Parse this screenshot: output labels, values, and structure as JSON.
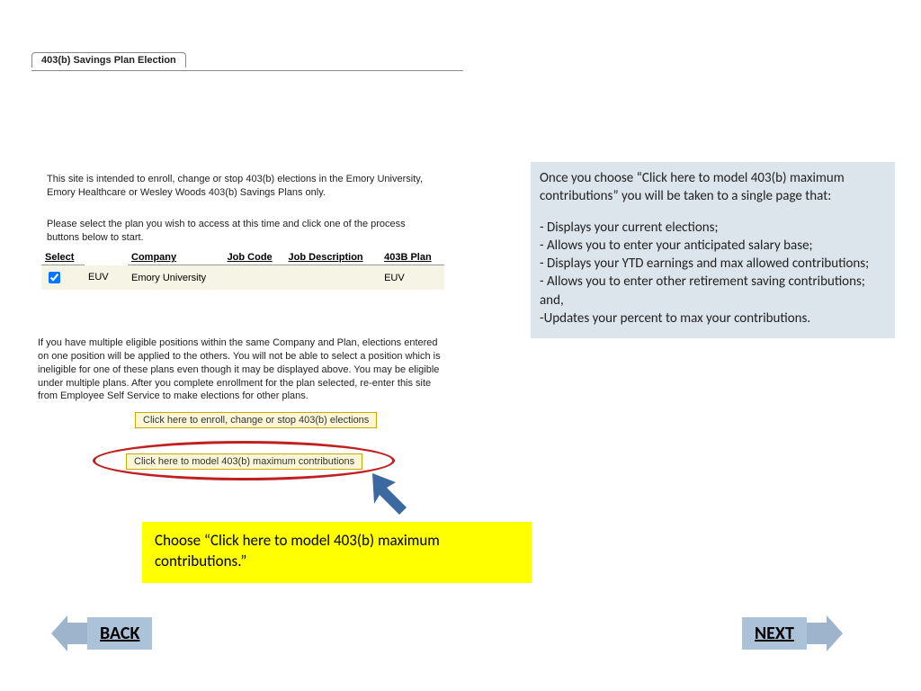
{
  "tab": {
    "title": "403(b) Savings Plan Election"
  },
  "site": {
    "intro": "This site is intended to enroll, change or stop 403(b) elections in the Emory University, Emory Healthcare or Wesley Woods 403(b) Savings Plans only.",
    "select_prompt": "Please select the plan you wish to access at this time and click one of the process buttons below to start."
  },
  "table": {
    "headers": {
      "select": "Select",
      "company": "Company",
      "jobcode": "Job Code",
      "jobdesc": "Job Description",
      "plan": "403B Plan"
    },
    "row": {
      "company_code": "EUV",
      "company_name": "Emory University",
      "jobcode": "",
      "jobdesc": "",
      "plan": "EUV"
    }
  },
  "multi": "If you have multiple eligible positions within the same Company and Plan, elections entered on one position will be applied to the others. You will not be able to select a position which is ineligible for one of these plans even though it may be displayed above. You may be eligible under multiple plans. After you complete enrollment for the plan selected, re-enter this site from Employee Self Service to make elections for other plans.",
  "buttons": {
    "enroll": "Click here to enroll, change or stop 403(b) elections",
    "model": "Click here to model 403(b) maximum contributions"
  },
  "yellow_callout": "Choose “Click here to model 403(b) maximum contributions.”",
  "info": {
    "intro": "Once you choose “Click here to model 403(b) maximum contributions” you will be taken to a single page that:",
    "b1": "- Displays your current elections;",
    "b2": "- Allows you to enter your anticipated salary base;",
    "b3": "- Displays your YTD earnings and max allowed contributions;",
    "b4": "- Allows you to enter other retirement saving contributions; and,",
    "b5": "-Updates your percent to max your contributions."
  },
  "nav": {
    "back": "BACK",
    "next": "NEXT"
  }
}
